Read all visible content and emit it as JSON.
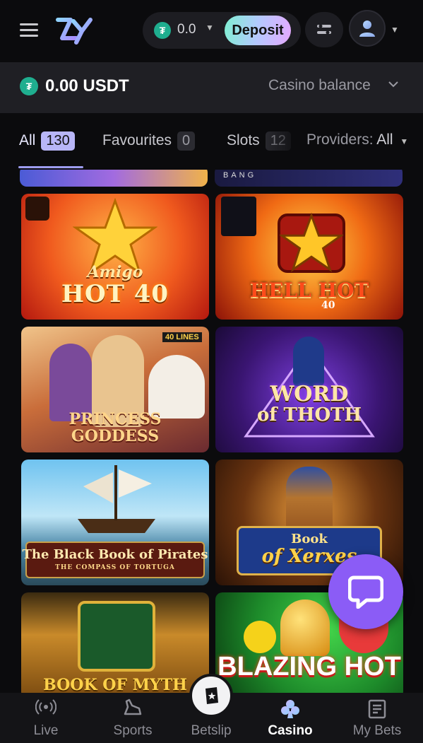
{
  "header": {
    "wallet_amount": "0.0",
    "deposit_label": "Deposit"
  },
  "balance": {
    "amount": "0.00 USDT",
    "selector_label": "Casino balance"
  },
  "tabs": [
    {
      "label": "All",
      "count": "130"
    },
    {
      "label": "Favourites",
      "count": "0"
    },
    {
      "label": "Slots",
      "count": "12"
    }
  ],
  "providers": {
    "label": "Providers:",
    "value": "All"
  },
  "games": [
    {
      "title_line1": "Amigo",
      "title_line2": "HOT 40"
    },
    {
      "title_line1": "HELL HOT",
      "title_line2": "40"
    },
    {
      "title_line1": "PRINCESS",
      "title_line2": "GODDESS",
      "badge": "40 LINES"
    },
    {
      "title_line1": "WORD",
      "title_line2": "of THOTH"
    },
    {
      "title_line1": "The Black Book of Pirates",
      "title_line2": "THE COMPASS OF TORTUGA"
    },
    {
      "title_line1": "Book",
      "title_line2": "of Xerxes"
    },
    {
      "title_line1": "BOOK OF MYTH"
    },
    {
      "title_line1": "BLAZING HOT"
    }
  ],
  "partial_tile_text": "BANG",
  "nav": [
    {
      "label": "Live",
      "icon": "live-icon"
    },
    {
      "label": "Sports",
      "icon": "sports-icon"
    },
    {
      "label": "Betslip",
      "icon": "betslip-icon"
    },
    {
      "label": "Casino",
      "icon": "casino-clubs-icon"
    },
    {
      "label": "My Bets",
      "icon": "my-bets-icon"
    }
  ],
  "colors": {
    "accent": "#8b5cf6",
    "usdt": "#1fae8f",
    "background": "#0b0b0d"
  }
}
